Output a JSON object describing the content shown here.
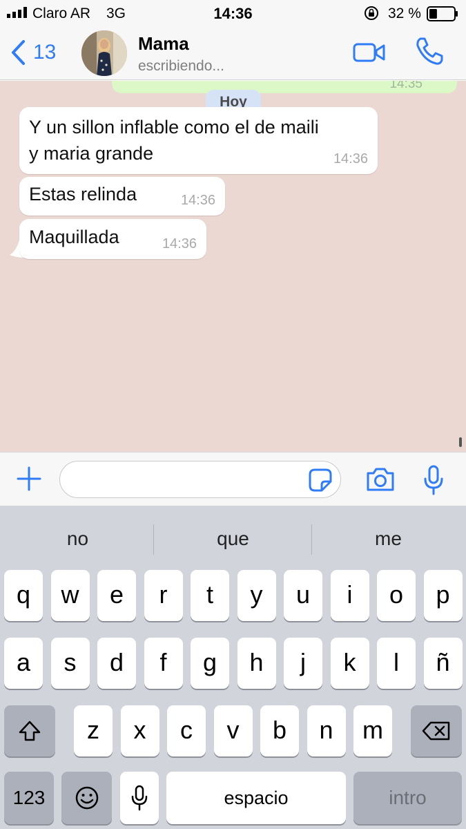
{
  "status_bar": {
    "carrier": "Claro AR",
    "network": "3G",
    "time": "14:36",
    "battery_percent": "32 %",
    "battery_level": 0.32
  },
  "header": {
    "back_count": "13",
    "contact_name": "Mama",
    "contact_status": "escribiendo..."
  },
  "chat": {
    "partial_outgoing_time": "14:35",
    "day_label": "Hoy",
    "messages": [
      {
        "text_line1": "Y un sillon inflable como el de maili",
        "text_line2": "y maria grande",
        "time": "14:36"
      },
      {
        "text": "Estas relinda",
        "time": "14:36"
      },
      {
        "text": "Maquillada",
        "time": "14:36"
      }
    ]
  },
  "input": {
    "placeholder": ""
  },
  "keyboard": {
    "suggestions": [
      "no",
      "que",
      "me"
    ],
    "row1": [
      "q",
      "w",
      "e",
      "r",
      "t",
      "y",
      "u",
      "i",
      "o",
      "p"
    ],
    "row2": [
      "a",
      "s",
      "d",
      "f",
      "g",
      "h",
      "j",
      "k",
      "l",
      "ñ"
    ],
    "row3": [
      "z",
      "x",
      "c",
      "v",
      "b",
      "n",
      "m"
    ],
    "numbers_key": "123",
    "space_key": "espacio",
    "return_key": "intro"
  },
  "icons": {
    "back": "chevron-left-icon",
    "video": "video-camera-icon",
    "call": "phone-icon",
    "plus": "plus-icon",
    "sticker": "sticker-icon",
    "camera": "camera-icon",
    "mic": "microphone-icon",
    "shift": "shift-icon",
    "delete": "backspace-icon",
    "emoji": "emoji-icon",
    "dictation": "dictation-mic-icon"
  },
  "colors": {
    "accent": "#2f7cf6",
    "chat_background": "#ecd8d3",
    "incoming_bubble": "#ffffff",
    "outgoing_bubble": "#dcf8c6",
    "day_pill": "#d6e3f7"
  }
}
